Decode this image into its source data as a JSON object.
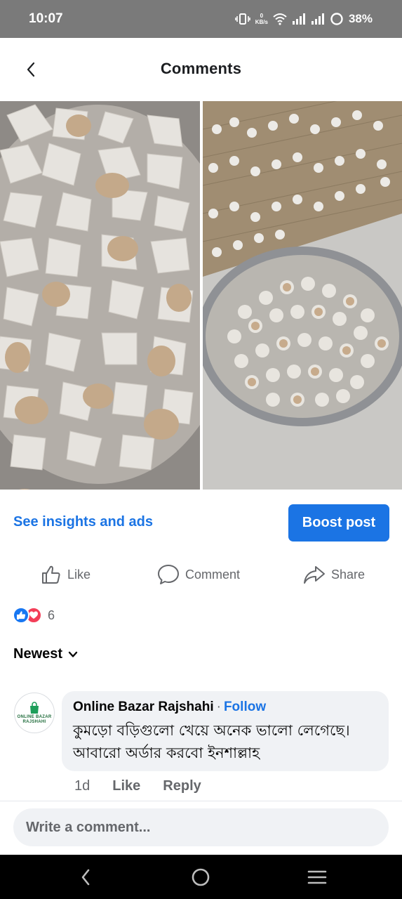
{
  "status_bar": {
    "time": "10:07",
    "net_speed_value": "0",
    "net_speed_unit": "KB/s",
    "battery": "38%"
  },
  "header": {
    "title": "Comments"
  },
  "post": {
    "insights_link": "See insights and ads",
    "boost_button": "Boost post",
    "actions": {
      "like": "Like",
      "comment": "Comment",
      "share": "Share"
    },
    "reaction_count": "6"
  },
  "sort": {
    "label": "Newest"
  },
  "comment": {
    "avatar_line1": "ONLINE BAZAR",
    "avatar_line2": "RAJSHAHI",
    "author": "Online Bazar Rajshahi",
    "separator": "·",
    "follow": "Follow",
    "text_line1": "কুমড়ো বড়িগুলো খেয়ে অনেক ভালো লেগেছে।",
    "text_line2": "আবারো অর্ডার করবো ইনশাল্লাহ",
    "time": "1d",
    "like": "Like",
    "reply": "Reply"
  },
  "composer": {
    "placeholder": "Write a comment..."
  },
  "colors": {
    "accent": "#1b74e4",
    "secondary_text": "#65676b",
    "bubble_bg": "#f0f2f5",
    "status_bar_bg": "#7a7a7a"
  },
  "icons": {
    "back": "chevron-left-icon",
    "like": "thumbs-up-icon",
    "comment": "speech-bubble-icon",
    "share": "share-arrow-icon",
    "sort": "chevron-down-icon",
    "nav_back": "nav-back-icon",
    "nav_home": "nav-home-icon",
    "nav_menu": "nav-menu-icon"
  }
}
